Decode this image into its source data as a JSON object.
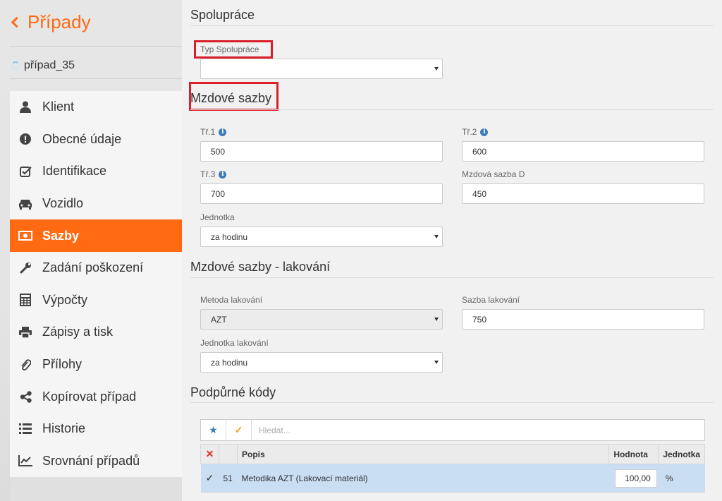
{
  "sidebar": {
    "back_label": "Případy",
    "case_name": "případ_35",
    "items": [
      {
        "label": "Klient",
        "icon": "user-icon"
      },
      {
        "label": "Obecné údaje",
        "icon": "exclamation-icon"
      },
      {
        "label": "Identifikace",
        "icon": "checkbox-icon"
      },
      {
        "label": "Vozidlo",
        "icon": "car-icon"
      },
      {
        "label": "Sazby",
        "icon": "money-icon"
      },
      {
        "label": "Zadání poškození",
        "icon": "wrench-icon"
      },
      {
        "label": "Výpočty",
        "icon": "calculator-icon"
      },
      {
        "label": "Zápisy a tisk",
        "icon": "printer-icon"
      },
      {
        "label": "Přílohy",
        "icon": "paperclip-icon"
      },
      {
        "label": "Kopírovat případ",
        "icon": "share-icon"
      },
      {
        "label": "Historie",
        "icon": "list-icon"
      },
      {
        "label": "Srovnání případů",
        "icon": "chart-icon"
      }
    ],
    "active_index": 4
  },
  "spoluprace": {
    "title": "Spolupráce",
    "typ_label": "Typ Spolupráce",
    "typ_value": ""
  },
  "mzdove": {
    "title": "Mzdové sazby",
    "tr1_label": "Tř.1",
    "tr1_value": "500",
    "tr2_label": "Tř.2",
    "tr2_value": "600",
    "tr3_label": "Tř.3",
    "tr3_value": "700",
    "sazbaD_label": "Mzdová sazba D",
    "sazbaD_value": "450",
    "jednotka_label": "Jednotka",
    "jednotka_value": "za hodinu"
  },
  "lakovani": {
    "title": "Mzdové sazby - lakování",
    "metoda_label": "Metoda lakování",
    "metoda_value": "AZT",
    "sazba_label": "Sazba lakování",
    "sazba_value": "750",
    "jednotka_label": "Jednotka lakování",
    "jednotka_value": "za hodinu"
  },
  "kody": {
    "title": "Podpůrné kódy",
    "search_placeholder": "Hledat...",
    "columns": {
      "popis": "Popis",
      "hodnota": "Hodnota",
      "jednotka": "Jednotka"
    },
    "rows": [
      {
        "num": "51",
        "popis": "Metodika AZT (Lakovací materiál)",
        "hodnota": "100,00",
        "jednotka": "%"
      }
    ]
  },
  "colors": {
    "accent": "#ff6a13",
    "highlight": "#d9202a",
    "row_selected": "#c9ddf3"
  }
}
